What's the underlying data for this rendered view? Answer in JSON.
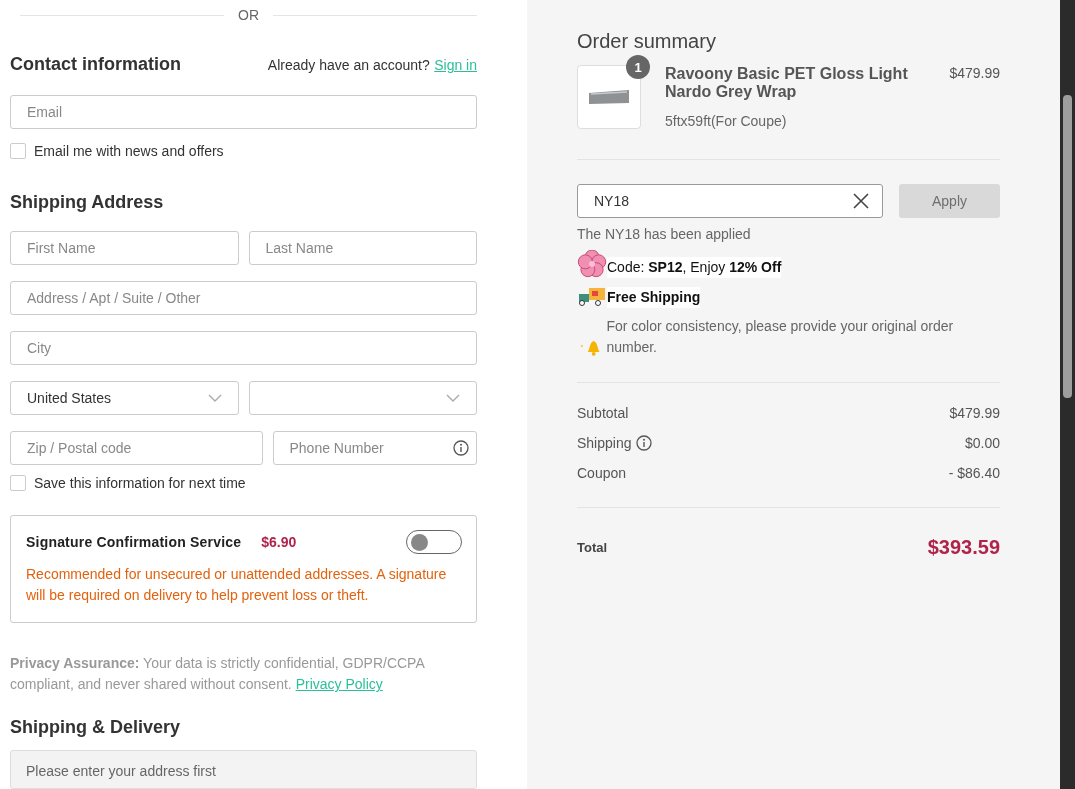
{
  "divider_text": "OR",
  "contact": {
    "heading": "Contact information",
    "account_prompt": "Already have an account?",
    "sign_in_link": "Sign in",
    "email": {
      "placeholder": "Email"
    },
    "newsletter": {
      "label": "Email me with news and offers",
      "checked": false
    }
  },
  "shipping_address": {
    "heading": "Shipping Address",
    "rows": [
      [
        {
          "kind": "text",
          "placeholder": "First Name"
        },
        {
          "kind": "text",
          "placeholder": "Last Name"
        }
      ],
      [
        {
          "kind": "text",
          "placeholder": "Address / Apt / Suite / Other"
        }
      ],
      [
        {
          "kind": "text",
          "placeholder": "City"
        }
      ],
      [
        {
          "kind": "select",
          "value": "United States"
        },
        {
          "kind": "select"
        }
      ],
      [
        {
          "kind": "text",
          "placeholder": "Zip / Postal code"
        },
        {
          "kind": "info",
          "placeholder": "Phone Number"
        }
      ]
    ],
    "save_info": {
      "label": "Save this information for next time",
      "checked": false
    }
  },
  "signature_service": {
    "title": "Signature Confirmation Service",
    "price": "$6.90",
    "on": false,
    "description": "Recommended for unsecured or unattended addresses. A signature will be required on delivery to help prevent loss or theft."
  },
  "privacy": {
    "text": "**Privacy Assurance:** Your data is strictly confidential, GDPR/CCPA compliant, and never shared without consent.",
    "link": "Privacy Policy"
  },
  "shipping_delivery": {
    "heading": "Shipping & Delivery",
    "message": "Please enter your address first"
  },
  "order_summary": {
    "title": "Order summary",
    "items": [
      {
        "quantity": "1",
        "name": "Ravoony Basic PET Gloss Light Nardo Grey Wrap",
        "variant": "5ftx59ft(For Coupe)",
        "price": "$479.99"
      }
    ],
    "coupon": {
      "value": "NY18",
      "button": "Apply",
      "disabled": true,
      "message": "The NY18 has been applied"
    },
    "promos": [
      {
        "kind": "flower",
        "text": "Code: **SP12**, Enjoy **12% Off**",
        "bold": false
      },
      {
        "kind": "truck",
        "text": "Free Shipping",
        "bold": true
      },
      {
        "kind": "bell",
        "text": "For color consistency, please provide your original order number.",
        "bold": false
      }
    ],
    "lines": [
      {
        "label": "Subtotal",
        "value": "$479.99",
        "info": false
      },
      {
        "label": "Shipping",
        "value": "$0.00",
        "info": true
      },
      {
        "label": "Coupon",
        "value": "- $86.40",
        "info": false
      }
    ],
    "total": {
      "label": "Total",
      "value": "$393.59"
    }
  }
}
